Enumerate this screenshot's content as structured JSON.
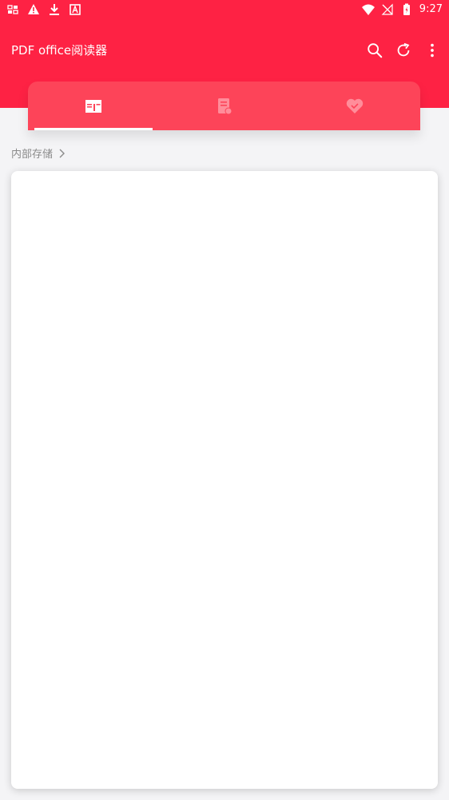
{
  "status_bar": {
    "time": "9:27",
    "left_icons": [
      "sim-icon",
      "warning-icon",
      "download-icon",
      "app-a-icon"
    ],
    "right_icons": [
      "wifi-icon",
      "no-signal-icon",
      "battery-icon"
    ]
  },
  "app_bar": {
    "title": "PDF office阅读器",
    "actions": [
      "search-icon",
      "refresh-icon",
      "more-vert-icon"
    ]
  },
  "tabs": [
    {
      "icon": "folder-book-icon",
      "selected": true
    },
    {
      "icon": "document-icon",
      "selected": false
    },
    {
      "icon": "heart-icon",
      "selected": false
    }
  ],
  "breadcrumb": {
    "label": "内部存储"
  },
  "colors": {
    "primary": "#fe2244",
    "tab_bar": "#fd4459",
    "background": "#f4f4f6"
  }
}
